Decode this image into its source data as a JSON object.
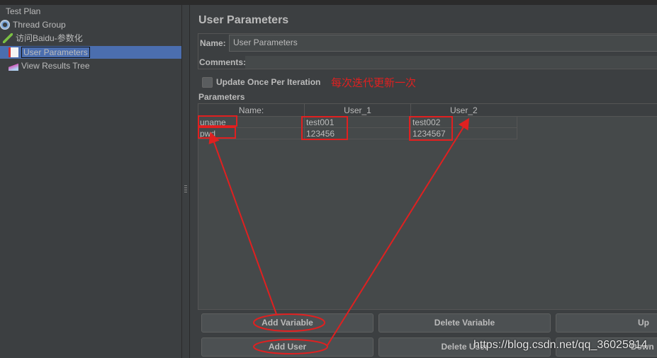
{
  "tree": {
    "items": [
      {
        "label": "Test Plan",
        "icon": "test-plan-icon"
      },
      {
        "label": "Thread Group",
        "icon": "gear-icon"
      },
      {
        "label": "访问Baidu-参数化",
        "icon": "sampler-pipette-icon"
      },
      {
        "label": "User Parameters",
        "icon": "preprocessor-icon",
        "selected": true
      },
      {
        "label": "View Results Tree",
        "icon": "listener-chart-icon"
      }
    ]
  },
  "panel": {
    "title": "User Parameters",
    "name_label": "Name:",
    "name_value": "User Parameters",
    "comments_label": "Comments:",
    "checkbox_label": "Update Once Per Iteration",
    "checkbox_checked": false,
    "parameters_label": "Parameters"
  },
  "table": {
    "headers": [
      "Name:",
      "User_1",
      "User_2"
    ],
    "rows": [
      [
        "uname",
        "test001",
        "test002"
      ],
      [
        "pwd",
        "123456",
        "1234567"
      ]
    ]
  },
  "buttons": {
    "add_variable": "Add Variable",
    "delete_variable": "Delete Variable",
    "up": "Up",
    "add_user": "Add User",
    "delete_user": "Delete User",
    "down": "Down"
  },
  "annotations": {
    "note": "每次迭代更新一次",
    "color": "#e02020"
  },
  "watermark": "https://blog.csdn.net/qq_36025814"
}
